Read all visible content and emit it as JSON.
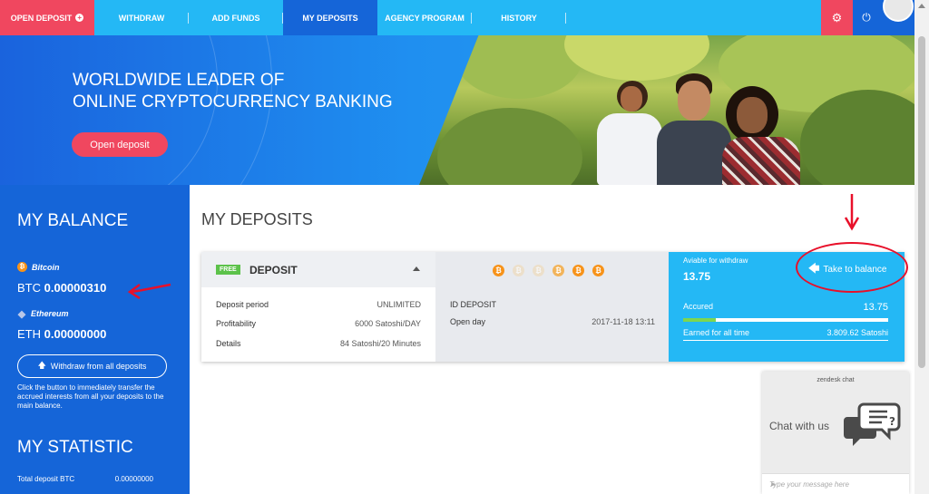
{
  "nav": {
    "open_deposit": "OPEN DEPOSIT",
    "items": [
      "WITHDRAW",
      "ADD FUNDS",
      "MY DEPOSITS",
      "AGENCY PROGRAM",
      "HISTORY"
    ],
    "active": "MY DEPOSITS",
    "accent": "#f0475f",
    "nav_bg": "#24b8f5",
    "active_bg": "#1565d8"
  },
  "hero": {
    "title_line1": "WORLDWIDE LEADER OF",
    "title_line2": "ONLINE CRYPTOCURRENCY BANKING",
    "button": "Open deposit"
  },
  "balance": {
    "title": "MY BALANCE",
    "bitcoin_label": "Bitcoin",
    "btc_prefix": "BTC",
    "btc_value": "0.00000310",
    "ethereum_label": "Ethereum",
    "eth_prefix": "ETH",
    "eth_value": "0.00000000",
    "withdraw_button": "Withdraw from all deposits",
    "note": "Click the button to immediately transfer the accrued interests from all your deposits to the main balance."
  },
  "statistic": {
    "title": "MY STATISTIC",
    "total_deposit_label": "Total deposit BTC",
    "total_deposit_value": "0.00000000"
  },
  "main": {
    "title": "MY DEPOSITS"
  },
  "deposit": {
    "badge": "FREE",
    "title": "DEPOSIT",
    "rows": [
      {
        "label": "Deposit period",
        "value": "UNLIMITED"
      },
      {
        "label": "Profitability",
        "value": "6000 Satoshi/DAY"
      },
      {
        "label": "Details",
        "value": "84 Satoshi/20 Minutes"
      }
    ],
    "id_label": "ID DEPOSIT",
    "open_day_label": "Open day",
    "open_day_value": "2017-11-18 13:11",
    "available_label": "Aviable for withdraw",
    "available_value": "13.75",
    "take_button": "Take to balance",
    "accured_label": "Accured",
    "accured_value": "13.75",
    "progress_fraction": 0.16,
    "earned_label": "Earned for all time",
    "earned_value": "3.809.62 Satoshi"
  },
  "chat": {
    "header": "zendesk chat",
    "title": "Chat with us",
    "placeholder": "Type your message here"
  }
}
